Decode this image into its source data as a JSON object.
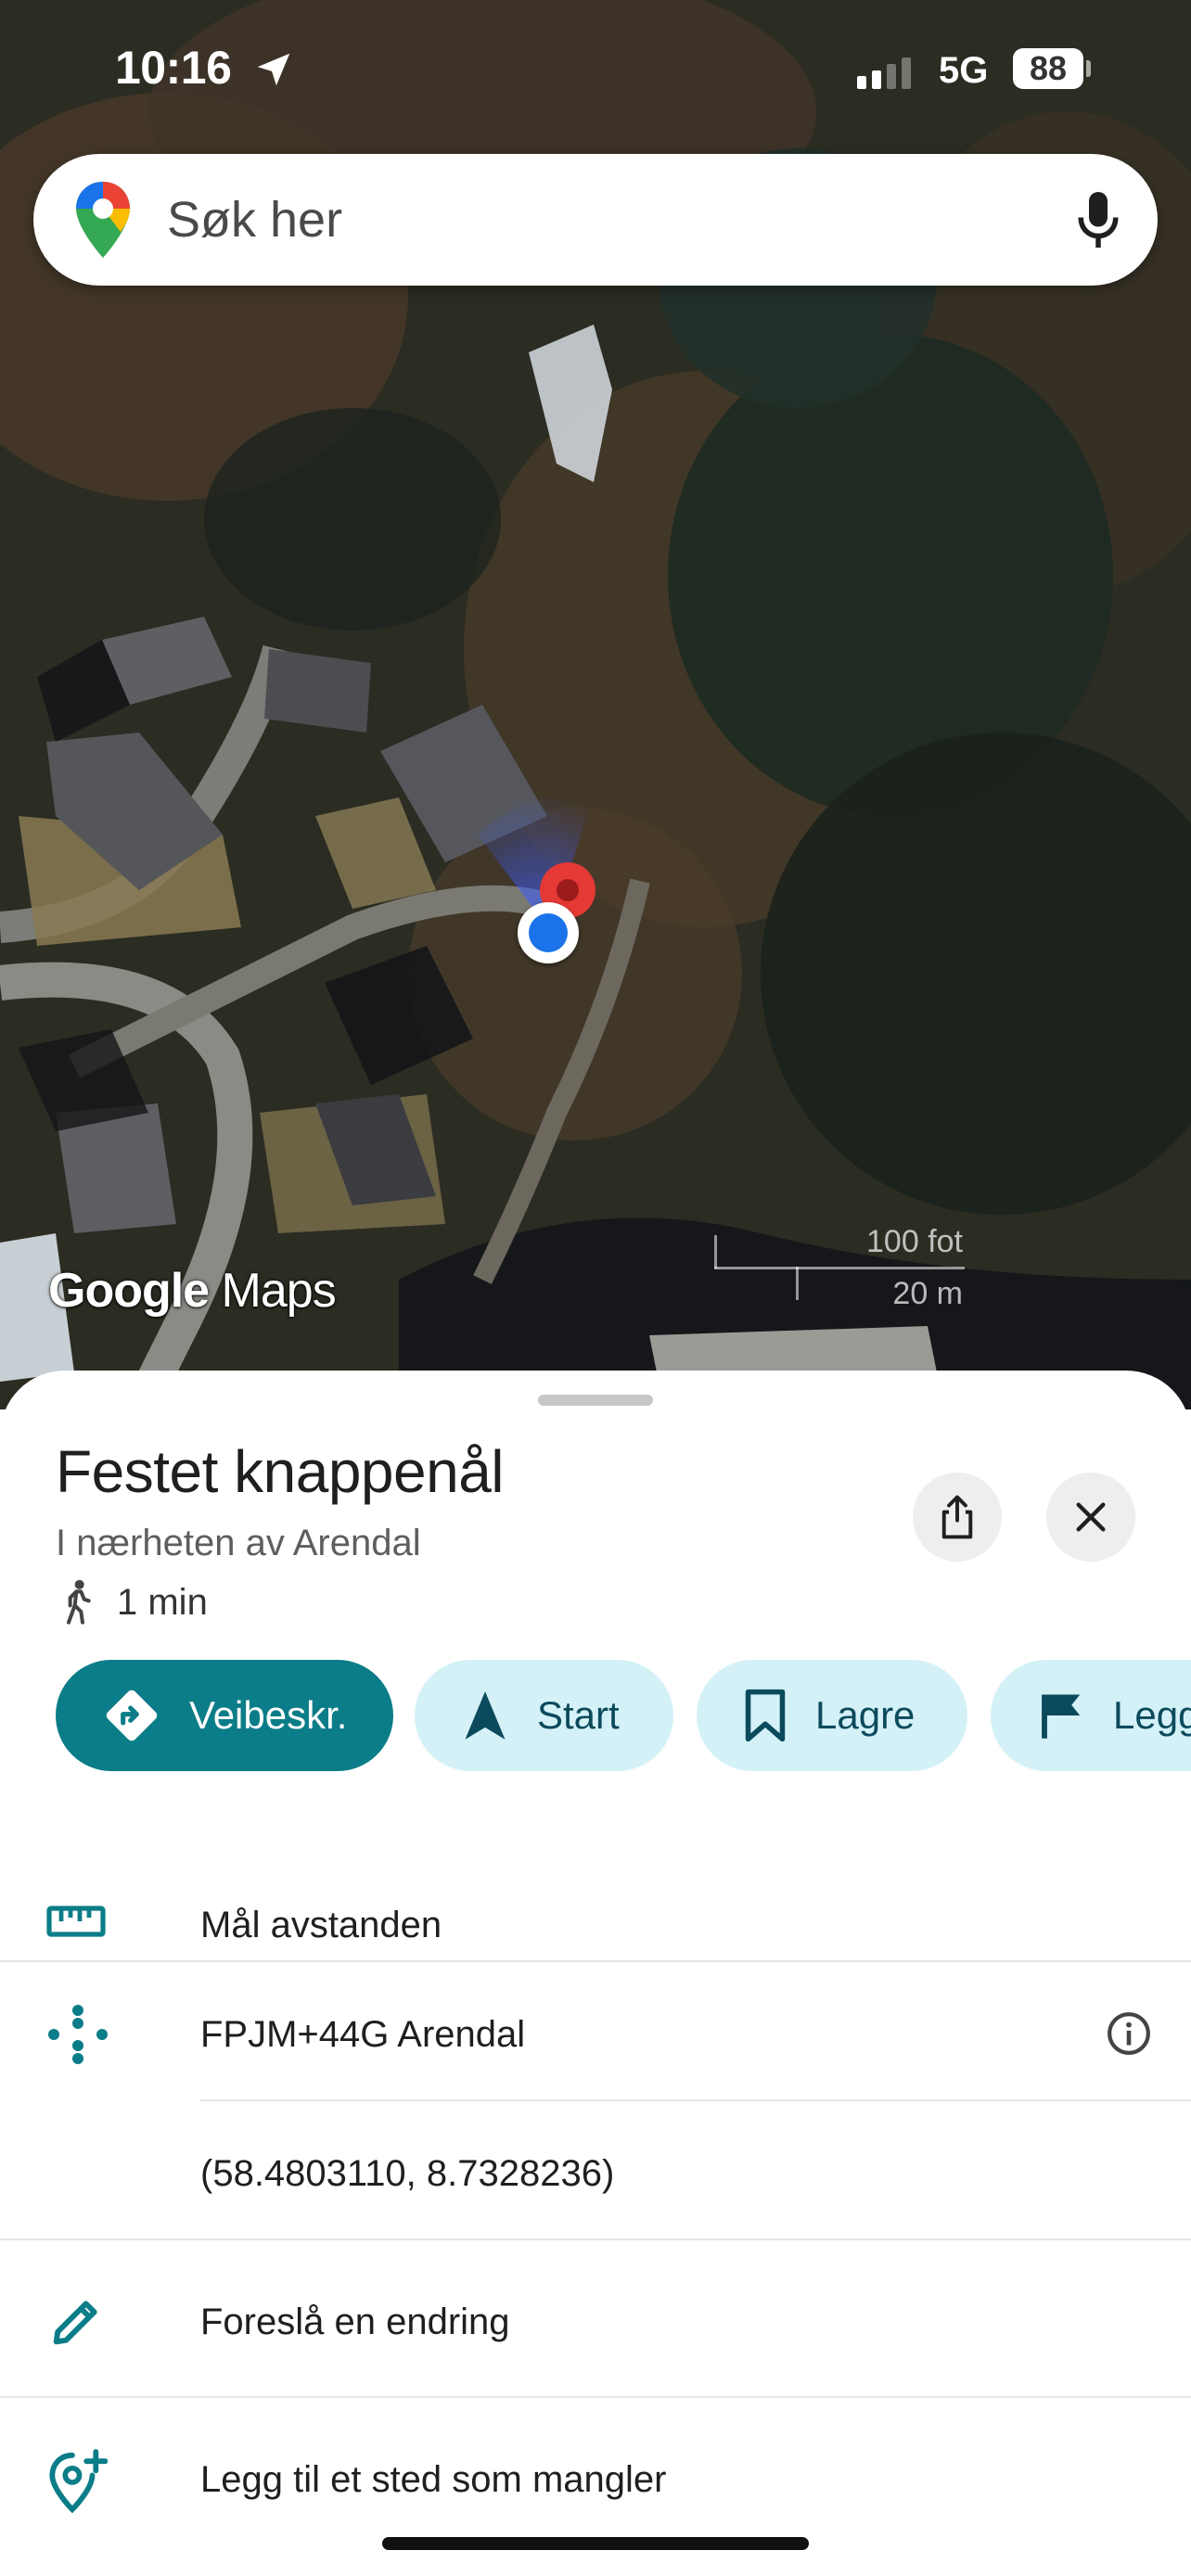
{
  "status_bar": {
    "time": "10:16",
    "network": "5G",
    "battery": "88",
    "icons": [
      "location-arrow-icon",
      "signal-bars-icon",
      "battery-icon"
    ]
  },
  "search": {
    "placeholder": "Søk her",
    "icons": [
      "google-maps-pin-icon",
      "microphone-icon"
    ]
  },
  "map": {
    "logo_bold": "Google",
    "logo_light": " Maps",
    "scale_top": "100 fot",
    "scale_bottom": "20 m"
  },
  "sheet": {
    "title": "Festet knappenål",
    "subtitle": "I nærheten av Arendal",
    "walk_time": "1 min",
    "chips": [
      {
        "label": "Veibeskr.",
        "icon": "directions-icon"
      },
      {
        "label": "Start",
        "icon": "navigation-arrow-icon"
      },
      {
        "label": "Lagre",
        "icon": "bookmark-icon"
      },
      {
        "label": "Legg",
        "icon": "flag-icon"
      }
    ],
    "items": {
      "measure": "Mål avstanden",
      "plus_code": "FPJM+44G Arendal",
      "coordinates": "(58.4803110, 8.7328236)",
      "suggest_edit": "Foreslå en endring",
      "add_place": "Legg til et sted som mangler"
    }
  },
  "colors": {
    "accent": "#0b7d88",
    "chip_bg": "#d4f1f8",
    "location_dot": "#1a73e8",
    "pin": "#e53935"
  }
}
